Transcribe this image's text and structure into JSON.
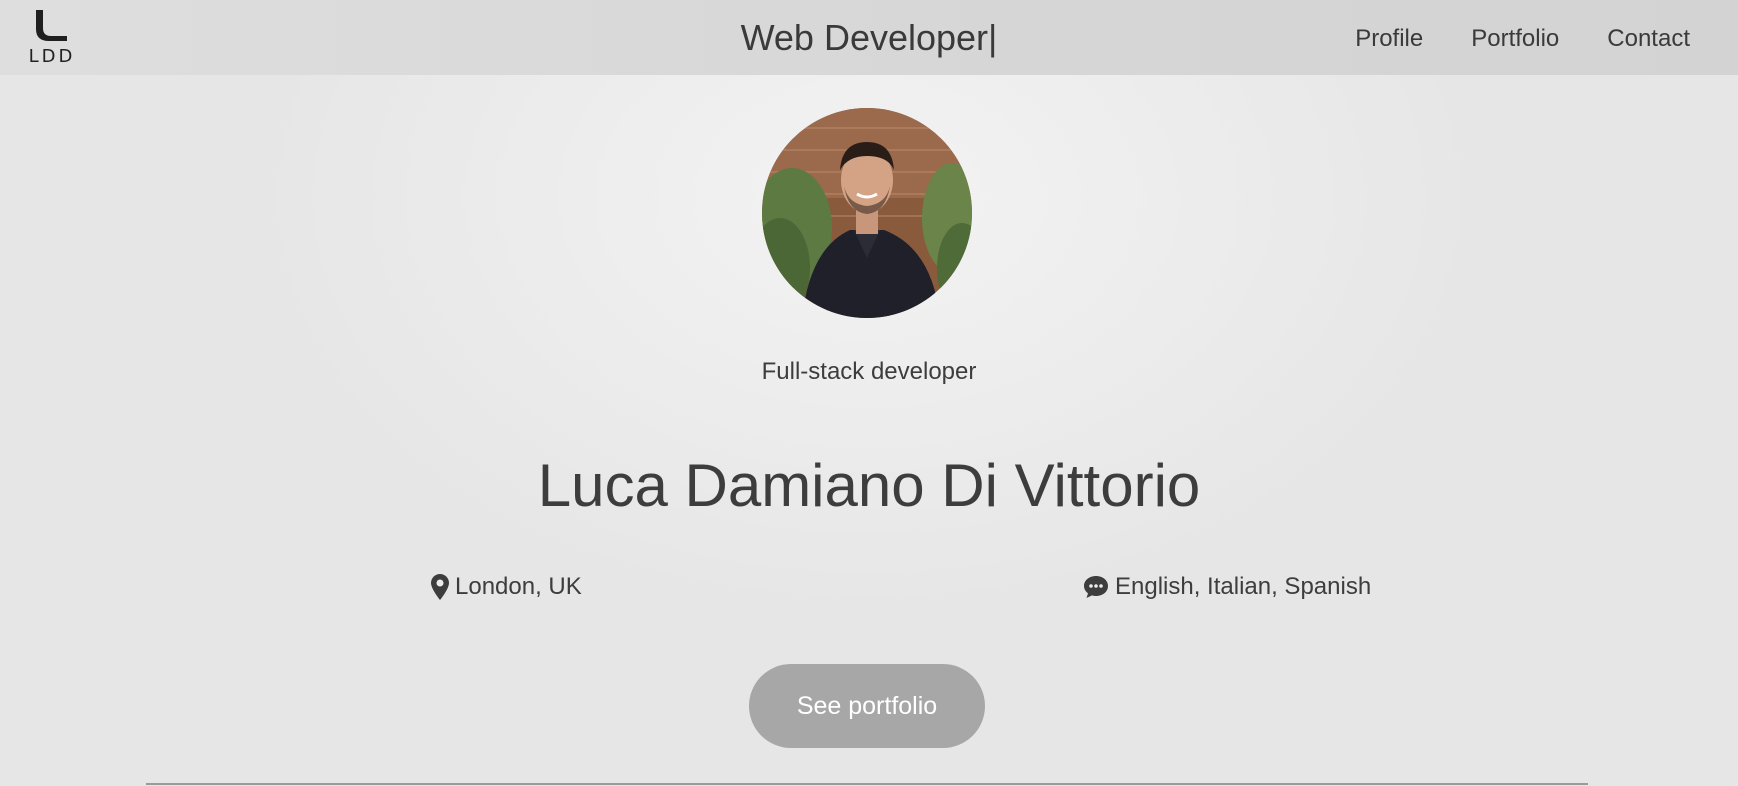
{
  "header": {
    "logo_text": "LDD",
    "title": "Web Developer",
    "cursor": "|",
    "nav": [
      {
        "label": "Profile"
      },
      {
        "label": "Portfolio"
      },
      {
        "label": "Contact"
      }
    ]
  },
  "hero": {
    "role": "Full-stack developer",
    "name": "Luca Damiano Di Vittorio",
    "location": "London, UK",
    "languages": "English, Italian, Spanish",
    "cta_label": "See portfolio"
  },
  "icons": {
    "location": "map-pin-icon",
    "languages": "chat-bubble-icon"
  },
  "colors": {
    "navbar": "#d6d6d6",
    "text": "#3d3d3d",
    "button": "#a7a7a7",
    "button_text": "#ffffff"
  }
}
